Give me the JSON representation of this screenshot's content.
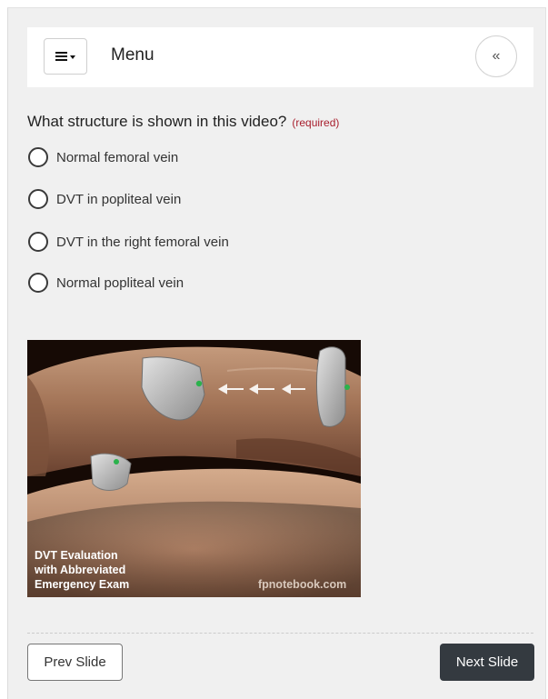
{
  "header": {
    "menu_label": "Menu",
    "collapse_glyph": "«",
    "menu_icon": "hamburger-icon"
  },
  "question": {
    "text": "What structure is shown in this video?",
    "required_label": "(required)",
    "options": [
      {
        "label": "Normal femoral vein",
        "selected": false
      },
      {
        "label": "DVT in popliteal vein",
        "selected": false
      },
      {
        "label": "DVT in the right femoral vein",
        "selected": false
      },
      {
        "label": "Normal popliteal vein",
        "selected": false
      }
    ]
  },
  "video": {
    "caption_lines": [
      "DVT Evaluation",
      "with Abbreviated",
      "Emergency Exam"
    ],
    "watermark": "fpnotebook.com"
  },
  "navigation": {
    "prev_label": "Prev Slide",
    "next_label": "Next Slide"
  },
  "colors": {
    "panel_background": "#f0f0f0",
    "required_text": "#a81e2d",
    "next_button": "#343a40",
    "probe_marker": "#2bb24c"
  }
}
